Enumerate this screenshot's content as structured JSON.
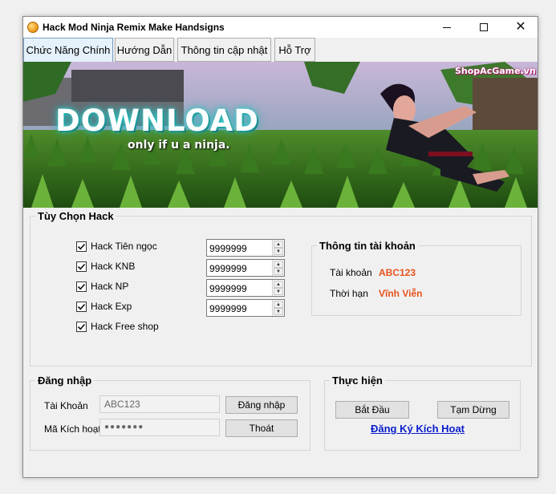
{
  "window": {
    "title": "Hack Mod Ninja Remix Make Handsigns"
  },
  "tabs": [
    {
      "label": "Chức Năng Chính"
    },
    {
      "label": "Hướng Dẫn"
    },
    {
      "label": "Thông tin cập nhật"
    },
    {
      "label": "Hỗ Trợ"
    }
  ],
  "banner": {
    "title": "DOWNLOAD",
    "subtitle": "only if u a ninja.",
    "brand": "ShopAcGame.vn"
  },
  "hack_options": {
    "title": "Tùy Chọn Hack",
    "items": [
      {
        "label": "Hack Tiên ngọc",
        "checked": true,
        "value": "9999999"
      },
      {
        "label": "Hack KNB",
        "checked": true,
        "value": "9999999"
      },
      {
        "label": "Hack NP",
        "checked": true,
        "value": "9999999"
      },
      {
        "label": "Hack Exp",
        "checked": true,
        "value": "9999999"
      },
      {
        "label": "Hack Free shop",
        "checked": true
      }
    ]
  },
  "account_info": {
    "title": "Thông tin tài khoản",
    "account_label": "Tài khoản",
    "account_value": "ABC123",
    "term_label": "Thời hạn",
    "term_value": "Vĩnh Viễn"
  },
  "login": {
    "title": "Đăng nhập",
    "account_label": "Tài Khoản",
    "account_value": "ABC123",
    "key_label": "Mã Kích hoạt",
    "key_value": "●●●●●●●",
    "login_button": "Đăng nhập",
    "exit_button": "Thoát"
  },
  "actions": {
    "title": "Thực hiện",
    "start_button": "Bắt Đầu",
    "pause_button": "Tạm Dừng",
    "register_link": "Đăng Ký Kích Hoạt"
  },
  "colors": {
    "accent_value": "#e8521b",
    "link": "#0a1ecc",
    "active_tab": "#e5f1fb"
  }
}
